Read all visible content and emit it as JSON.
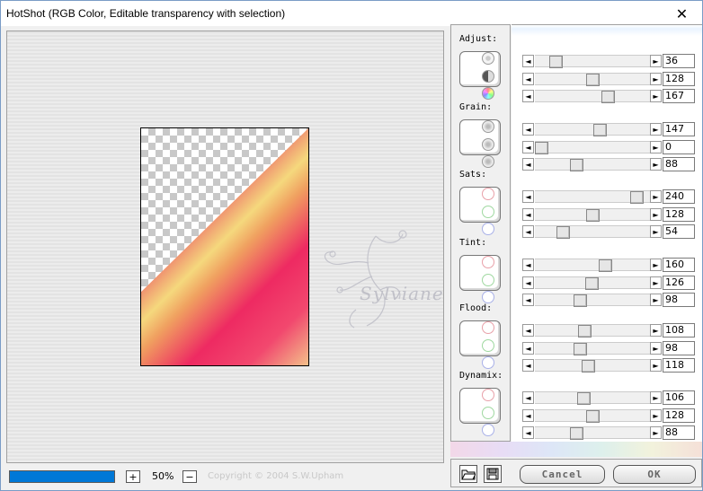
{
  "window": {
    "title": "HotShot (RGB Color, Editable transparency with selection)",
    "close_glyph": "✕"
  },
  "preview": {
    "watermark_text": "Sylviane"
  },
  "status": {
    "zoom_in": "+",
    "zoom_level": "50%",
    "zoom_out": "−",
    "copyright": "Copyright © 2004 S.W.Upham",
    "progress": 1.0
  },
  "groups": [
    {
      "label": "Adjust:",
      "values": [
        36,
        128,
        167
      ],
      "icons": [
        "sun-icon",
        "contrast-icon",
        "color-wheel-icon"
      ]
    },
    {
      "label": "Grain:",
      "values": [
        147,
        0,
        88
      ],
      "icons": [
        "grain-icon",
        "grain-icon",
        "grain-icon"
      ]
    },
    {
      "label": "Sats:",
      "values": [
        240,
        128,
        54
      ],
      "icons": [
        "red-dot-icon",
        "green-dot-icon",
        "blue-dot-icon"
      ]
    },
    {
      "label": "Tint:",
      "values": [
        160,
        126,
        98
      ],
      "icons": [
        "red-dot-icon",
        "green-dot-icon",
        "blue-dot-icon"
      ]
    },
    {
      "label": "Flood:",
      "values": [
        108,
        98,
        118
      ],
      "icons": [
        "red-dot-icon",
        "green-dot-icon",
        "blue-dot-icon"
      ]
    },
    {
      "label": "Dynamix:",
      "values": [
        106,
        128,
        88
      ],
      "icons": [
        "red-dot-icon",
        "green-dot-icon",
        "blue-dot-icon"
      ]
    }
  ],
  "slider_arrows": {
    "left": "◄",
    "right": "►"
  },
  "buttons": {
    "cancel": "Cancel",
    "ok": "OK"
  },
  "colors": {
    "progress": "#0078d7",
    "dot_red": "#e8a0a8",
    "dot_green": "#9fd8a0",
    "dot_blue": "#a8b0e8"
  }
}
